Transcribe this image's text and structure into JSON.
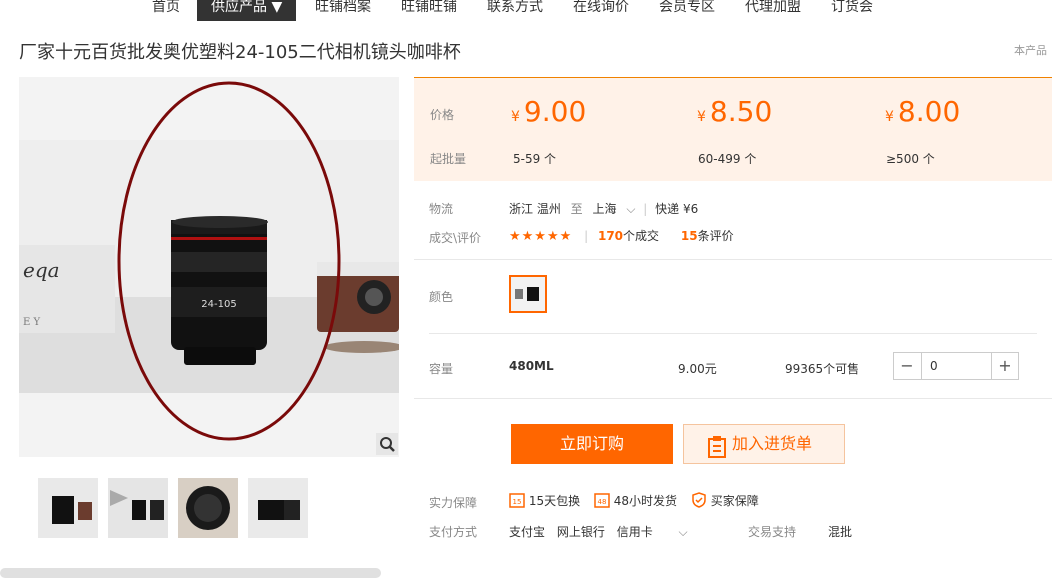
{
  "nav": {
    "items": [
      "首页",
      "供应产品 ▼",
      "旺铺档案",
      "旺铺旺铺",
      "联系方式",
      "在线询价",
      "会员专区",
      "代理加盟",
      "订货会"
    ]
  },
  "product": {
    "title": "厂家十元百货批发奥优塑料24-105二代相机镜头咖啡杯",
    "corner_text": "本产品",
    "lens_text": "24-105"
  },
  "pricing": {
    "price_label": "价格",
    "moq_label": "起批量",
    "currency": "¥",
    "tiers": [
      {
        "price": "9.00",
        "range": "5-59 个"
      },
      {
        "price": "8.50",
        "range": "60-499 个"
      },
      {
        "price": "8.00",
        "range": "≥500 个"
      }
    ]
  },
  "logistics": {
    "label": "物流",
    "from": "浙江 温州",
    "to_word": "至",
    "to": "上海",
    "express": "快递 ¥6"
  },
  "deals": {
    "label": "成交\\评价",
    "stars": "★★★★★",
    "rating": 5,
    "sold_count": "170",
    "sold_suffix": "个成交",
    "review_count": "15",
    "review_suffix": "条评价"
  },
  "color": {
    "label": "颜色"
  },
  "capacity": {
    "label": "容量",
    "value": "480ML",
    "unit_price": "9.00元",
    "stock": "99365个可售",
    "qty": "0",
    "minus": "−",
    "plus": "+"
  },
  "actions": {
    "buy": "立即订购",
    "cart": "加入进货单"
  },
  "guarantee": {
    "label": "实力保障",
    "items": [
      {
        "badge": "15",
        "text": "15天包换"
      },
      {
        "badge": "48",
        "text": "48小时发货"
      },
      {
        "badge": "",
        "text": "买家保障"
      }
    ]
  },
  "payment": {
    "label": "支付方式",
    "methods": [
      "支付宝",
      "网上银行",
      "信用卡"
    ],
    "trade_label": "交易支持",
    "trade_value": "混批"
  },
  "colors": {
    "accent": "#ff6600",
    "price_bg": "#fff2e8",
    "nav_active": "#333333",
    "annotation": "#7a0a0a"
  }
}
